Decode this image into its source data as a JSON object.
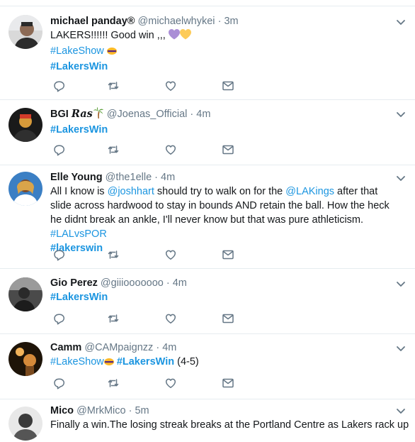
{
  "tweets": [
    {
      "name": "michael panday",
      "verified_mark": "®",
      "handle": "@michaelwhykei",
      "time": "3m",
      "text1": "LAKERS!!!!!! Good win ,,,",
      "tag1": "#LakeShow",
      "tag2": "#LakersWin"
    },
    {
      "name": "BGI",
      "name_suffix": "Ras",
      "handle": "@Joenas_Official",
      "time": "4m",
      "tag1": "#LakersWin"
    },
    {
      "name": "Elle Young",
      "handle": "@the1elle",
      "time": "4m",
      "t_a": "All I know is ",
      "m1": "@joshhart",
      "t_b": " should try to walk on for the ",
      "m2": "@LAKings",
      "t_c": " after that slide across hardwood to stay in bounds AND retain the ball. How the heck he didnt break an ankle, I'll never know but that was pure athleticism. ",
      "tag1": "#LALvsPOR",
      "tag2": "#lakerswin"
    },
    {
      "name": "Gio Perez",
      "handle": "@giiiooooooo",
      "time": "4m",
      "tag1": "#LakersWin"
    },
    {
      "name": "Camm",
      "handle": "@CAMpaignzz",
      "time": "4m",
      "tag1": "#LakeShow",
      "tag2": "#LakersWin",
      "tail": "(4-5)"
    },
    {
      "name": "Mico",
      "handle": "@MrkMico",
      "time": "5m",
      "text1": "Finally a win.The losing streak breaks at the Portland Centre as Lakers rack up"
    }
  ],
  "sep": "·",
  "icons": [
    "reply-icon",
    "retweet-icon",
    "like-icon",
    "message-icon",
    "chevron-down-icon"
  ],
  "colors": {
    "link": "#1b95e0",
    "muted": "#657786",
    "icon": "#657786",
    "divider": "#e6ecf0"
  }
}
